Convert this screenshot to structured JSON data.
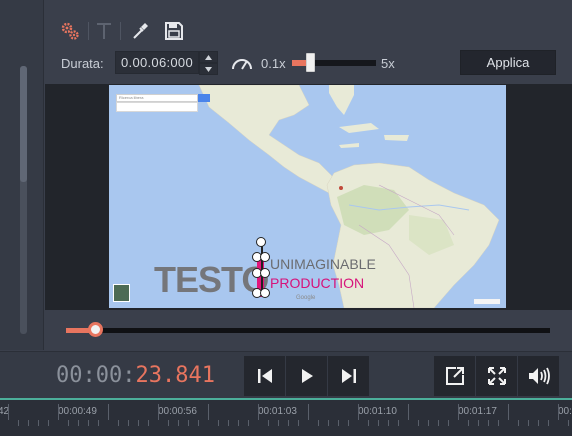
{
  "toolbar": {
    "tools": [
      "gears-icon",
      "text-icon",
      "eyedropper-icon",
      "save-icon"
    ],
    "duration_label": "Durata:",
    "duration_value": "0.00.06:000",
    "speed_min_label": "0.1x",
    "speed_max_label": "5x",
    "speed_value_fraction": 0.22,
    "apply_label": "Applica"
  },
  "preview": {
    "search_placeholder": "Ricerca libera",
    "map_credit": "Google",
    "title_main": "TESTO",
    "title_top": "UNIMAGINABLE",
    "title_bottom": "PRODUCTION"
  },
  "playback": {
    "progress_fraction": 0.06,
    "timecode_grey": "00:00:",
    "timecode_orange": "23.841",
    "buttons": [
      "skip-back-icon",
      "play-icon",
      "skip-forward-icon",
      "detach-icon",
      "fullscreen-icon",
      "volume-icon"
    ]
  },
  "timeline": {
    "labels": [
      "42",
      "00:00:49",
      "00:00:56",
      "00:01:03",
      "00:01:10",
      "00:01:17",
      "00:0"
    ]
  },
  "colors": {
    "accent": "#e8755f",
    "title_pink": "#e2167c",
    "map_water": "#a9c7ef",
    "map_land": "#e8ead7",
    "timeline_line": "#4caf9a"
  }
}
